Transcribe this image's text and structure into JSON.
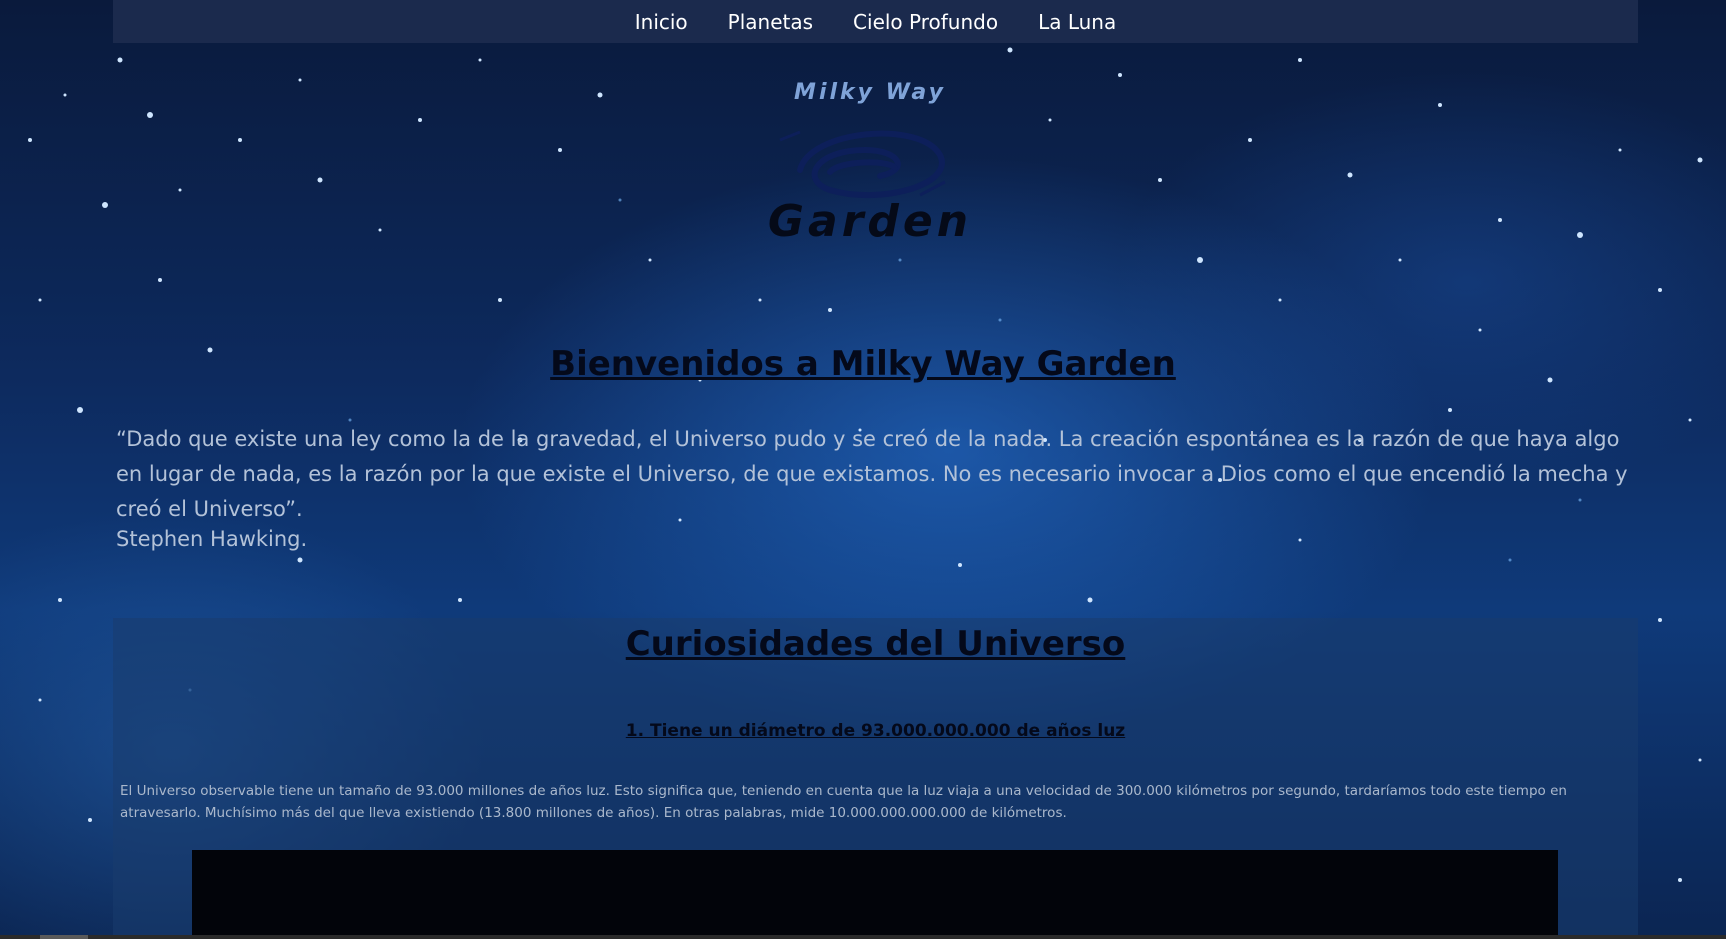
{
  "nav": {
    "items": [
      {
        "label": "Inicio"
      },
      {
        "label": "Planetas"
      },
      {
        "label": "Cielo Profundo"
      },
      {
        "label": "La Luna"
      }
    ]
  },
  "logo": {
    "top_text": "Milky Way",
    "bottom_text": "Garden"
  },
  "hero": {
    "title": "Bienvenidos a Milky Way Garden",
    "quote": "“Dado que existe una ley como la de la gravedad, el Universo pudo y se creó de la nada. La creación espontánea es la razón de que haya algo en lugar de nada, es la razón por la que existe el Universo, de que existamos. No es necesario invocar a Dios como el que encendió la mecha y creó el Universo”.",
    "author": "Stephen Hawking."
  },
  "curiosities": {
    "title": "Curiosidades del Universo",
    "facts": [
      {
        "title": "1. Tiene un diámetro de 93.000.000.000 de años luz",
        "text": "El Universo observable tiene un tamaño de 93.000 millones de años luz. Esto significa que, teniendo en cuenta que la luz viaja a una velocidad de 300.000 kilómetros por segundo, tardaríamos todo este tiempo en atravesarlo. Muchísimo más del que lleva existiendo (13.800 millones de años). En otras palabras, mide 10.000.000.000.000 de kilómetros."
      }
    ]
  },
  "colors": {
    "nav_bg": "#1b2a4d",
    "heading": "#04091a",
    "quote_text": "#b3c2d8",
    "section_bg": "#193c6e"
  }
}
